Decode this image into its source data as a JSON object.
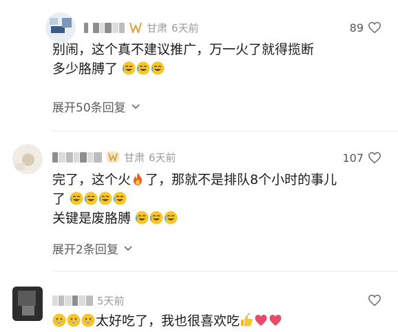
{
  "colors": {
    "background": "#ffffff",
    "text": "#1a1a1a",
    "meta": "#9a9a9a",
    "vip_gold": "#d9a748",
    "heart_red": "#e84a6a",
    "divider": "#ececec"
  },
  "comments": [
    {
      "username_masked": "▖ ▛▌▗▌",
      "location": "甘肃",
      "time": "6天前",
      "likes": "89",
      "text_lines": [
        "别闹，这个真不建议推广，万一火了就得揽断",
        "多少胳膊了"
      ],
      "emoji_line2": "crying-laughing-face-icon ×3",
      "expand_label": "展开50条回复"
    },
    {
      "username_masked": "▖ ▛▌▗▌",
      "location": "甘肃",
      "time": "6天前",
      "likes": "107",
      "text_line1_a": "完了，这个火",
      "text_line1_b": "了，那就不是排队8个小时的事儿",
      "text_line2": "了",
      "text_line3": "关键是废胳膊",
      "expand_label": "展开2条回复"
    },
    {
      "username_masked": "▖ ▛▌▗▌",
      "time": "5天前",
      "text_main": "太好吃了，我也很喜欢吃"
    }
  ]
}
